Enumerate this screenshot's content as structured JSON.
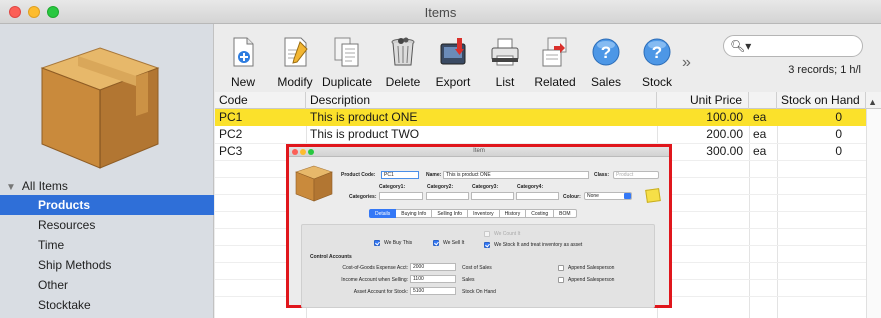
{
  "window": {
    "title": "Items"
  },
  "sidebar": {
    "group_label": "All Items",
    "items": [
      {
        "label": "Products",
        "selected": true
      },
      {
        "label": "Resources",
        "selected": false
      },
      {
        "label": "Time",
        "selected": false
      },
      {
        "label": "Ship Methods",
        "selected": false
      },
      {
        "label": "Other",
        "selected": false
      },
      {
        "label": "Stocktake",
        "selected": false
      }
    ]
  },
  "toolbar": {
    "buttons": [
      {
        "label": "New",
        "icon": "new-document-icon"
      },
      {
        "label": "Modify",
        "icon": "edit-document-icon"
      },
      {
        "label": "Duplicate",
        "icon": "duplicate-icon"
      },
      {
        "label": "Delete",
        "icon": "trash-icon"
      },
      {
        "label": "Export",
        "icon": "export-icon"
      },
      {
        "label": "List",
        "icon": "printer-icon"
      },
      {
        "label": "Related",
        "icon": "related-icon"
      },
      {
        "label": "Sales",
        "icon": "help-icon"
      },
      {
        "label": "Stock",
        "icon": "help-icon"
      }
    ],
    "more": "»",
    "search": {
      "placeholder": "",
      "value": ""
    },
    "records_text": "3 records; 1 h/l"
  },
  "table": {
    "columns": [
      "Code",
      "Description",
      "Unit Price",
      "",
      "Stock on Hand"
    ],
    "rows": [
      {
        "code": "PC1",
        "description": "This is product ONE",
        "unit_price": "100.00",
        "unit": "ea",
        "stock": "0",
        "selected": true
      },
      {
        "code": "PC2",
        "description": "This is product TWO",
        "unit_price": "200.00",
        "unit": "ea",
        "stock": "0",
        "selected": false
      },
      {
        "code": "PC3",
        "description": "",
        "unit_price": "300.00",
        "unit": "ea",
        "stock": "0",
        "selected": false
      }
    ]
  },
  "item_window": {
    "title": "Item",
    "product_code_label": "Product Code:",
    "product_code_value": "PC1",
    "name_label": "Name:",
    "name_value": "This is product ONE",
    "class_label": "Class:",
    "class_value": "Product",
    "categories_label": "Categories:",
    "category_labels": [
      "Category1:",
      "Category2:",
      "Category3:",
      "Category4:"
    ],
    "colour_label": "Colour:",
    "colour_value": "None",
    "tabs": [
      "Details",
      "Buying Info",
      "Selling Info",
      "Inventory",
      "History",
      "Costing",
      "BOM"
    ],
    "active_tab": "Details",
    "we_buy_this": "We Buy This",
    "we_sell_it": "We Sell It",
    "we_count_it": "We Count It",
    "we_stock_it": "We Stock It and treat inventory as asset",
    "control_accounts_label": "Control Accounts",
    "cogs_label": "Cost-of-Goods Expense Acct:",
    "cogs_value": "2000",
    "cogs_desc": "Cost of Sales",
    "income_label": "Income Account when Selling:",
    "income_value": "1100",
    "income_desc": "Sales",
    "asset_label": "Asset Account for Stock:",
    "asset_value": "5100",
    "asset_desc": "Stock On Hand",
    "append_salesperson_1": "Append Salesperson",
    "append_salesperson_2": "Append Salesperson"
  },
  "colors": {
    "selection_row": "#fbe12b",
    "sidebar_selection": "#2f6fd8",
    "highlight_frame": "#e0161c"
  }
}
